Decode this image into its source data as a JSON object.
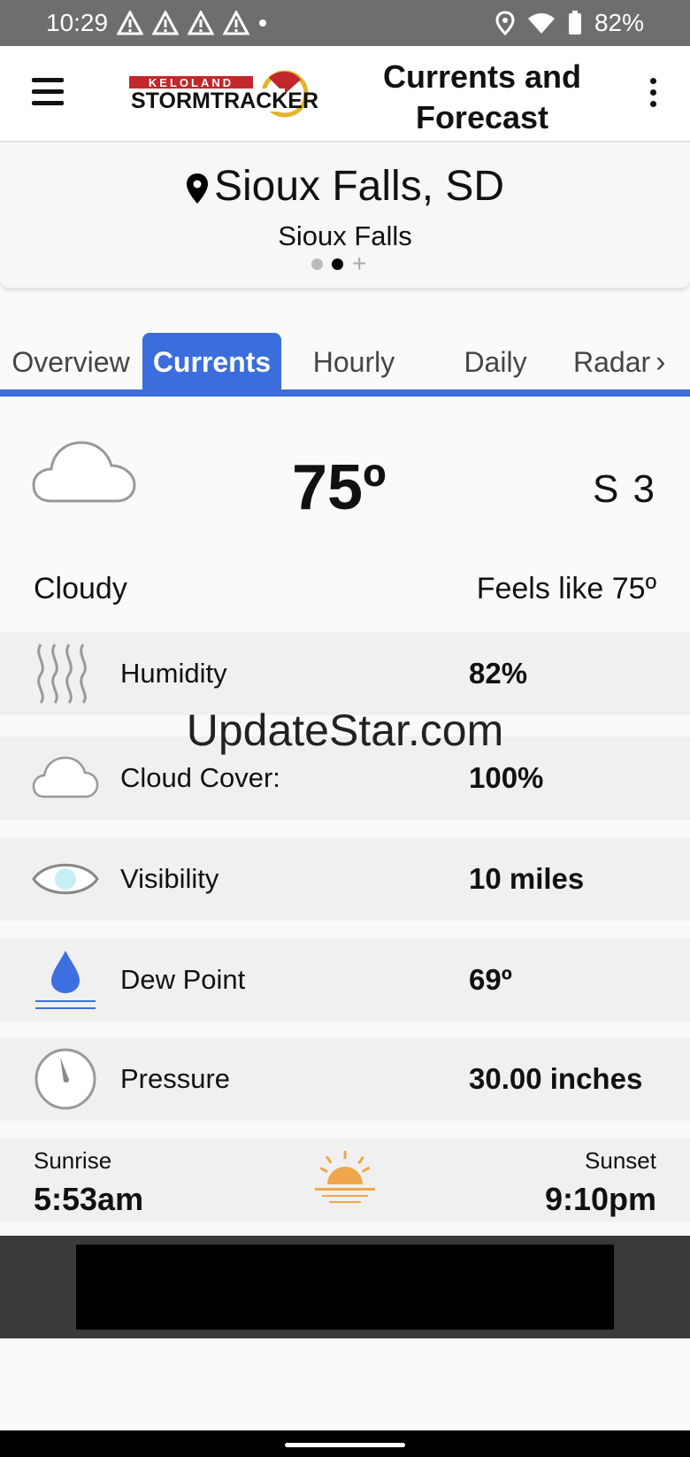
{
  "status_bar": {
    "time": "10:29",
    "battery": "82%"
  },
  "app_bar": {
    "title": "Currents and Forecast",
    "logo_top": "KELOLAND",
    "logo_bottom": "STORMTRACKER"
  },
  "location": {
    "name": "Sioux Falls, SD",
    "subtitle": "Sioux Falls",
    "plus": "+"
  },
  "tabs": [
    {
      "label": "Overview"
    },
    {
      "label": "Currents"
    },
    {
      "label": "Hourly"
    },
    {
      "label": "Daily"
    },
    {
      "label": "Radar"
    }
  ],
  "current": {
    "temperature": "75º",
    "wind": "S  3",
    "condition": "Cloudy",
    "feels_like": "Feels like 75º"
  },
  "details": [
    {
      "label": "Humidity",
      "value": "82%",
      "icon": "humidity-icon"
    },
    {
      "label": "Cloud Cover:",
      "value": "100%",
      "icon": "cloud-icon"
    },
    {
      "label": "Visibility",
      "value": "10 miles",
      "icon": "eye-icon"
    },
    {
      "label": "Dew Point",
      "value": "69º",
      "icon": "water-drop-icon"
    },
    {
      "label": "Pressure",
      "value": "30.00 inches",
      "icon": "gauge-icon"
    }
  ],
  "sun": {
    "sunrise_label": "Sunrise",
    "sunrise_time": "5:53am",
    "sunset_label": "Sunset",
    "sunset_time": "9:10pm"
  },
  "watermark": "UpdateStar.com",
  "colors": {
    "accent": "#3b6edc",
    "sun": "#f0a64a",
    "drop": "#3d6fe0"
  }
}
